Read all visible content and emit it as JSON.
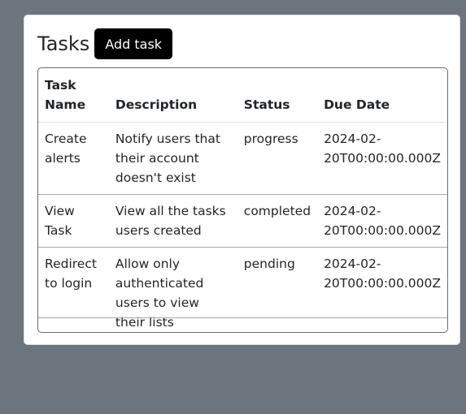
{
  "header": {
    "title": "Tasks",
    "add_label": "Add task"
  },
  "table": {
    "columns": [
      "Task Name",
      "Description",
      "Status",
      "Due Date"
    ],
    "rows": [
      {
        "name": "Create alerts",
        "description": "Notify users that their account doesn't exist",
        "status": "progress",
        "due": "2024-02-20T00:00:00.000Z"
      },
      {
        "name": "View Task",
        "description": "View all the tasks users created",
        "status": "completed",
        "due": "2024-02-20T00:00:00.000Z"
      },
      {
        "name": "Redirect to login",
        "description": "Allow only authenticated users to view their lists",
        "status": "pending",
        "due": "2024-02-20T00:00:00.000Z"
      }
    ]
  }
}
